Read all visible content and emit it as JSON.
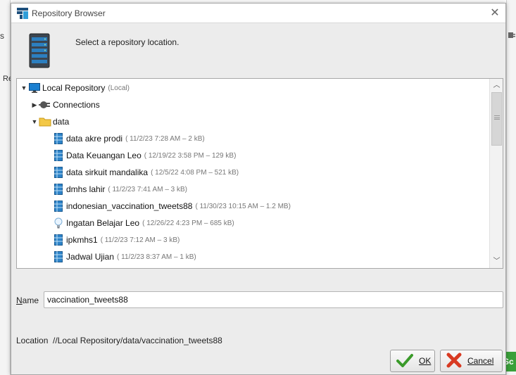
{
  "background": {
    "left_text_top": "s",
    "left_text_mid": "Re",
    "right_green_button": "Sc"
  },
  "dialog": {
    "title": "Repository Browser",
    "header_text": "Select a repository location."
  },
  "tree": {
    "root": {
      "label": "Local Repository",
      "meta": "(Local)"
    },
    "connections": {
      "label": "Connections"
    },
    "data_folder": {
      "label": "data"
    },
    "items": [
      {
        "label": "data akre prodi",
        "meta": "( 11/2/23 7:28 AM – 2 kB)",
        "icon": "data-table-icon"
      },
      {
        "label": "Data Keuangan Leo",
        "meta": "( 12/19/22 3:58 PM – 129 kB)",
        "icon": "data-table-icon"
      },
      {
        "label": "data sirkuit mandalika",
        "meta": "( 12/5/22 4:08 PM – 521 kB)",
        "icon": "data-table-icon"
      },
      {
        "label": "dmhs lahir",
        "meta": "( 11/2/23 7:41 AM – 3 kB)",
        "icon": "data-table-icon"
      },
      {
        "label": "indonesian_vaccination_tweets88",
        "meta": "( 11/30/23 10:15 AM – 1.2 MB)",
        "icon": "data-table-icon"
      },
      {
        "label": "Ingatan Belajar Leo",
        "meta": "( 12/26/22 4:23 PM – 685 kB)",
        "icon": "lightbulb-icon"
      },
      {
        "label": "ipkmhs1",
        "meta": "( 11/2/23 7:12 AM – 3 kB)",
        "icon": "data-table-icon"
      },
      {
        "label": "Jadwal Ujian",
        "meta": "( 11/2/23 8:37 AM – 1 kB)",
        "icon": "data-table-icon"
      }
    ]
  },
  "form": {
    "name_label_prefix": "N",
    "name_label_rest": "ame",
    "name_value": "vaccination_tweets88",
    "location_label": "Location",
    "location_value": "//Local Repository/data/vaccination_tweets88"
  },
  "buttons": {
    "ok_label": "OK",
    "cancel_label": "Cancel"
  }
}
